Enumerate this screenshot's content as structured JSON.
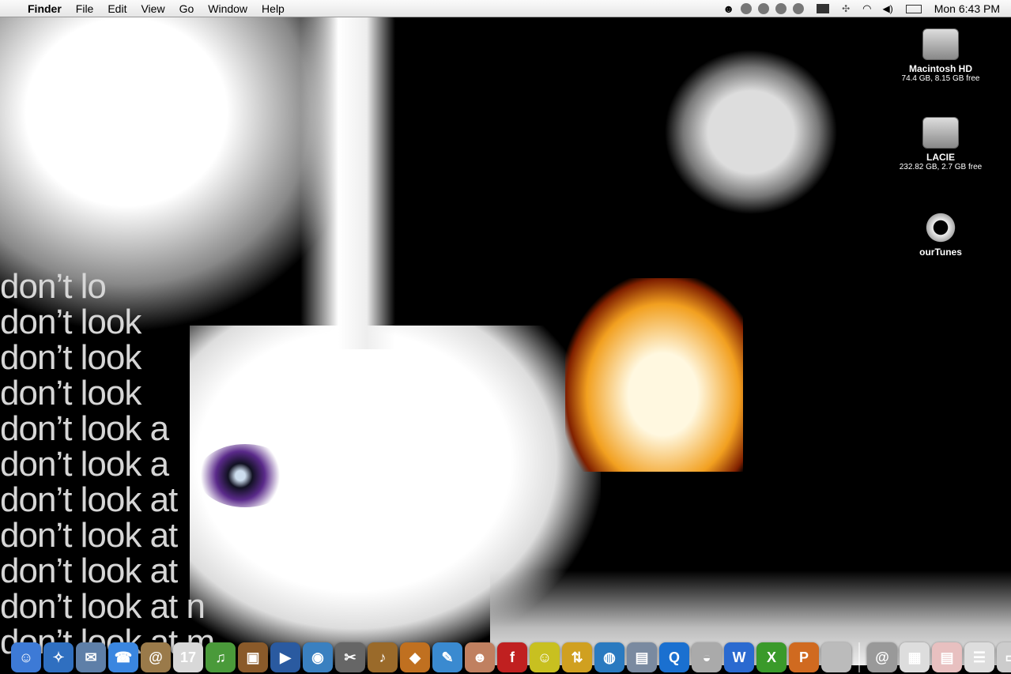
{
  "menubar": {
    "apple_icon": "apple-icon",
    "app_name": "Finder",
    "menus": [
      "File",
      "Edit",
      "View",
      "Go",
      "Window",
      "Help"
    ],
    "extras": [
      "user-icon",
      "itunes-previous-icon",
      "itunes-pause-icon",
      "itunes-next-icon",
      "itunes-menu-icon",
      "display-icon",
      "bluetooth-icon",
      "wifi-icon",
      "volume-icon",
      "battery-icon"
    ],
    "clock": "Mon 6:43 PM"
  },
  "desktop": {
    "icons": [
      {
        "name": "Macintosh HD",
        "info": "74.4 GB, 8.15 GB free",
        "icon": "hard-drive-icon"
      },
      {
        "name": "LACIE",
        "info": "232.82 GB, 2.7 GB free",
        "icon": "usb-drive-icon"
      },
      {
        "name": "ourTunes",
        "info": "",
        "icon": "ourtunes-icon"
      }
    ],
    "wallpaper_text": [
      "don’t lo",
      "don’t look",
      "don’t look",
      "don’t look",
      "don’t look a",
      "don’t look a",
      "don’t look at",
      "don’t look at",
      "don’t look at",
      "don’t look at n",
      "don’t look at m"
    ]
  },
  "dock": {
    "apps": [
      {
        "name": "finder",
        "glyph": "☺",
        "color": "#3d7ad6"
      },
      {
        "name": "safari",
        "glyph": "✧",
        "color": "#2f6fc0"
      },
      {
        "name": "mail",
        "glyph": "✉",
        "color": "#5e7fa8"
      },
      {
        "name": "ichat",
        "glyph": "☎",
        "color": "#3a86e0"
      },
      {
        "name": "address-book",
        "glyph": "@",
        "color": "#9a7a4a"
      },
      {
        "name": "ical",
        "glyph": "17",
        "color": "#d8d8d8"
      },
      {
        "name": "itunes",
        "glyph": "♫",
        "color": "#4a9a3a"
      },
      {
        "name": "iphoto",
        "glyph": "▣",
        "color": "#8a5a2a"
      },
      {
        "name": "imovie",
        "glyph": "▶",
        "color": "#2a5aa0"
      },
      {
        "name": "idvd",
        "glyph": "◉",
        "color": "#3a80c0"
      },
      {
        "name": "final-cut",
        "glyph": "✂",
        "color": "#666"
      },
      {
        "name": "garageband",
        "glyph": "♪",
        "color": "#9a6a2a"
      },
      {
        "name": "reason",
        "glyph": "◆",
        "color": "#c07020"
      },
      {
        "name": "feather-app",
        "glyph": "✎",
        "color": "#3a8ad0"
      },
      {
        "name": "photo-app",
        "glyph": "☻",
        "color": "#c08060"
      },
      {
        "name": "flash",
        "glyph": "f",
        "color": "#c02020"
      },
      {
        "name": "adium",
        "glyph": "☺",
        "color": "#c8c020"
      },
      {
        "name": "transmit",
        "glyph": "⇅",
        "color": "#d0a020"
      },
      {
        "name": "internet-connect",
        "glyph": "◍",
        "color": "#2a7ac0"
      },
      {
        "name": "network-browser",
        "glyph": "▤",
        "color": "#7a8aa0"
      },
      {
        "name": "quicktime",
        "glyph": "Q",
        "color": "#1a70d0"
      },
      {
        "name": "toast",
        "glyph": "◒",
        "color": "#aaa"
      },
      {
        "name": "word",
        "glyph": "W",
        "color": "#2a6ad0"
      },
      {
        "name": "excel",
        "glyph": "X",
        "color": "#3a9a2a"
      },
      {
        "name": "powerpoint",
        "glyph": "P",
        "color": "#d06a20"
      },
      {
        "name": "system-preferences",
        "glyph": "",
        "color": "#bbb"
      }
    ],
    "docs": [
      {
        "name": "mail-stack",
        "glyph": "@",
        "color": "#999"
      },
      {
        "name": "document-1",
        "glyph": "▦",
        "color": "#ddd"
      },
      {
        "name": "document-2",
        "glyph": "▤",
        "color": "#e8c0c0"
      },
      {
        "name": "document-3",
        "glyph": "☰",
        "color": "#ddd"
      },
      {
        "name": "document-4",
        "glyph": "▭",
        "color": "#ccc"
      },
      {
        "name": "trash",
        "glyph": "🗑",
        "color": "#777"
      }
    ]
  }
}
